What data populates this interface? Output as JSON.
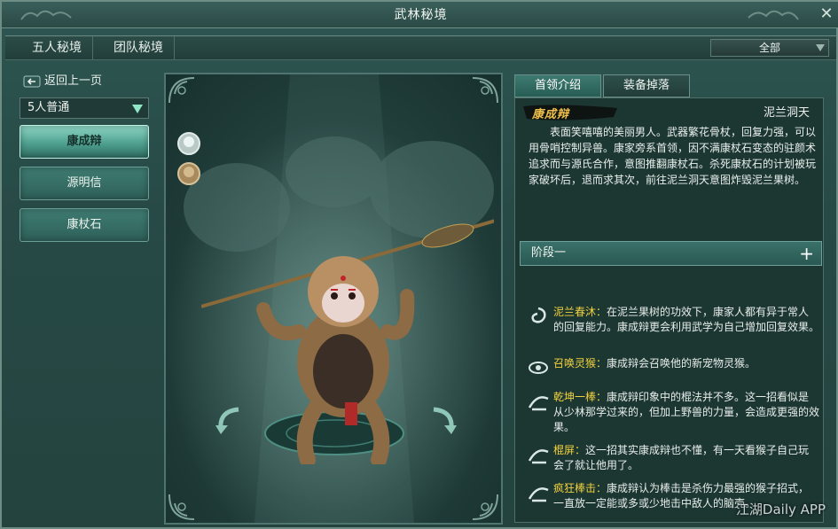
{
  "window": {
    "title": "武林秘境",
    "close_label": "✕"
  },
  "tabs": [
    {
      "label": "五人秘境"
    },
    {
      "label": "团队秘境"
    }
  ],
  "filter": {
    "selected": "全部"
  },
  "left_panel": {
    "back_label": "返回上一页",
    "difficulty": "5人普通",
    "bosses": [
      {
        "label": "康成辩",
        "active": true
      },
      {
        "label": "源明信",
        "active": false
      },
      {
        "label": "康杖石",
        "active": false
      }
    ]
  },
  "right_panel": {
    "tabs": [
      {
        "label": "首领介绍",
        "active": true
      },
      {
        "label": "装备掉落",
        "active": false
      }
    ],
    "boss_name": "康成辩",
    "location": "泥兰洞天",
    "description": "表面笑嘻嘻的美丽男人。武器繁花骨杖，回复力强，可以用骨哨控制异兽。康家旁系首领，因不满康杖石变态的驻颜术追求而与源氏合作，意图推翻康杖石。杀死康杖石的计划被玩家破坏后，退而求其次，前往泥兰洞天意图炸毁泥兰果树。",
    "stage_label": "阶段一",
    "stage_expand": "+",
    "skills": [
      {
        "name": "泥兰春沐：",
        "text": "在泥兰果树的功效下，康家人都有异于常人的回复能力。康成辩更会利用武学为自己增加回复效果。"
      },
      {
        "name": "召唤灵猴：",
        "text": "康成辩会召唤他的新宠物灵猴。"
      },
      {
        "name": "乾坤一棒：",
        "text": "康成辩印象中的棍法并不多。这一招看似是从少林那学过来的，但加上野兽的力量，会造成更强的效果。"
      },
      {
        "name": "棍屏：",
        "text": "这一招其实康成辩也不懂，有一天看猴子自己玩会了就让他用了。"
      },
      {
        "name": "疯狂棒击：",
        "text": "康成辩认为棒击是杀伤力最强的猴子招式，一直放一定能或多或少地击中敌人的脑壳。"
      }
    ]
  },
  "watermark": "江湖Daily APP",
  "colors": {
    "accent": "#f2d23e",
    "panel": "#1c3632",
    "highlight": "#8fd8c6"
  }
}
